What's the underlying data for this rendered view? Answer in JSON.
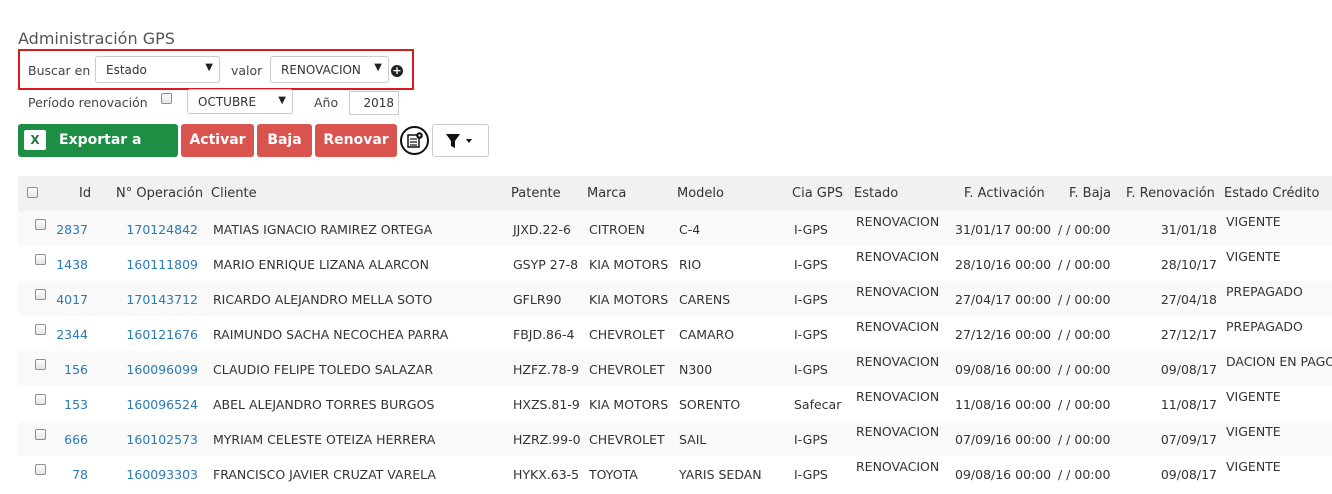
{
  "page_title": "Administración GPS",
  "search": {
    "buscar_label": "Buscar en",
    "field_value": "Estado",
    "valor_label": "valor",
    "valor_value": "RENOVACION"
  },
  "period": {
    "label": "Período renovación",
    "month": "OCTUBRE",
    "year_label": "Año",
    "year": "2018"
  },
  "toolbar": {
    "excel_icon": "X",
    "export_label": "Exportar a Excel",
    "activar_label": "Activar",
    "baja_label": "Baja",
    "renovar_label": "Renovar"
  },
  "table": {
    "headers": {
      "id": "Id",
      "operacion": "N° Operación",
      "cliente": "Cliente",
      "patente": "Patente",
      "marca": "Marca",
      "modelo": "Modelo",
      "cia": "Cia GPS",
      "estado": "Estado",
      "activacion": "F. Activación",
      "baja": "F. Baja",
      "renovacion": "F. Renovación",
      "credito": "Estado Crédito"
    },
    "rows": [
      {
        "id": "2837",
        "op": "170124842",
        "cliente": "MATIAS IGNACIO RAMIREZ ORTEGA",
        "patente": "JJXD.22-6",
        "marca": "CITROEN",
        "modelo": "C-4",
        "cia": "I-GPS",
        "estado": "RENOVACION",
        "activacion": "31/01/17 00:00",
        "baja": "/ / 00:00",
        "renovacion": "31/01/18",
        "credito": "VIGENTE"
      },
      {
        "id": "1438",
        "op": "160111809",
        "cliente": "MARIO ENRIQUE LIZANA ALARCON",
        "patente": "GSYP 27-8",
        "marca": "KIA MOTORS",
        "modelo": "RIO",
        "cia": "I-GPS",
        "estado": "RENOVACION",
        "activacion": "28/10/16 00:00",
        "baja": "/ / 00:00",
        "renovacion": "28/10/17",
        "credito": "VIGENTE"
      },
      {
        "id": "4017",
        "op": "170143712",
        "cliente": "RICARDO ALEJANDRO MELLA SOTO",
        "patente": "GFLR90",
        "marca": "KIA MOTORS",
        "modelo": "CARENS",
        "cia": "I-GPS",
        "estado": "RENOVACION",
        "activacion": "27/04/17 00:00",
        "baja": "/ / 00:00",
        "renovacion": "27/04/18",
        "credito": "PREPAGADO"
      },
      {
        "id": "2344",
        "op": "160121676",
        "cliente": "RAIMUNDO SACHA NECOCHEA PARRA",
        "patente": "FBJD.86-4",
        "marca": "CHEVROLET",
        "modelo": "CAMARO",
        "cia": "I-GPS",
        "estado": "RENOVACION",
        "activacion": "27/12/16 00:00",
        "baja": "/ / 00:00",
        "renovacion": "27/12/17",
        "credito": "PREPAGADO"
      },
      {
        "id": "156",
        "op": "160096099",
        "cliente": "CLAUDIO FELIPE TOLEDO SALAZAR",
        "patente": "HZFZ.78-9",
        "marca": "CHEVROLET",
        "modelo": "N300",
        "cia": "I-GPS",
        "estado": "RENOVACION",
        "activacion": "09/08/16 00:00",
        "baja": "/ / 00:00",
        "renovacion": "09/08/17",
        "credito": "DACION EN PAGO"
      },
      {
        "id": "153",
        "op": "160096524",
        "cliente": "ABEL ALEJANDRO TORRES BURGOS",
        "patente": "HXZS.81-9",
        "marca": "KIA MOTORS",
        "modelo": "SORENTO",
        "cia": "Safecar",
        "estado": "RENOVACION",
        "activacion": "11/08/16 00:00",
        "baja": "/ / 00:00",
        "renovacion": "11/08/17",
        "credito": "VIGENTE"
      },
      {
        "id": "666",
        "op": "160102573",
        "cliente": "MYRIAM CELESTE OTEIZA HERRERA",
        "patente": "HZRZ.99-0",
        "marca": "CHEVROLET",
        "modelo": "SAIL",
        "cia": "I-GPS",
        "estado": "RENOVACION",
        "activacion": "07/09/16 00:00",
        "baja": "/ / 00:00",
        "renovacion": "07/09/17",
        "credito": "VIGENTE"
      },
      {
        "id": "78",
        "op": "160093303",
        "cliente": "FRANCISCO JAVIER CRUZAT VARELA",
        "patente": "HYKX.63-5",
        "marca": "TOYOTA",
        "modelo": "YARIS SEDAN",
        "cia": "I-GPS",
        "estado": "RENOVACION",
        "activacion": "09/08/16 00:00",
        "baja": "/ / 00:00",
        "renovacion": "09/08/17",
        "credito": "VIGENTE"
      }
    ]
  }
}
